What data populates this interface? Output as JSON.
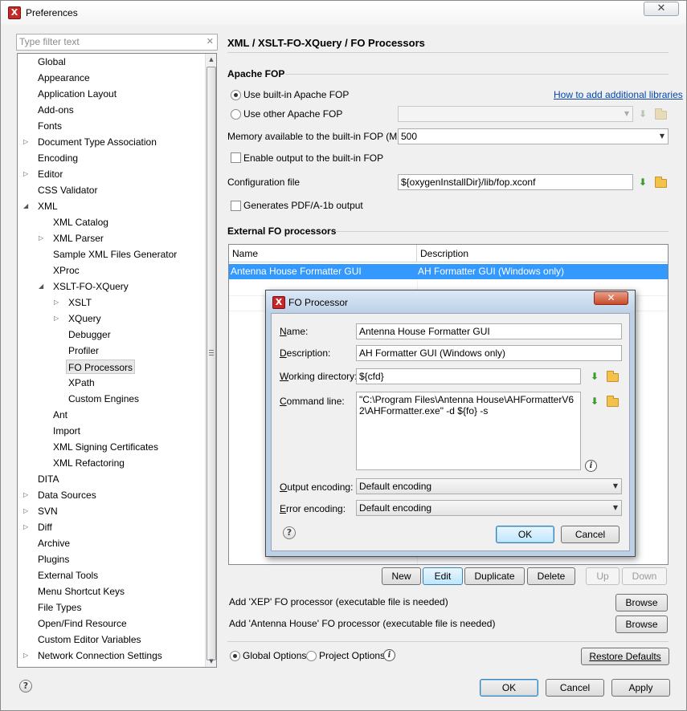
{
  "window": {
    "title": "Preferences",
    "close_glyph": "✕"
  },
  "filter": {
    "placeholder": "Type filter text",
    "clear_glyph": "✕"
  },
  "tree": [
    {
      "label": "Global",
      "level": 0,
      "expander": "none"
    },
    {
      "label": "Appearance",
      "level": 0,
      "expander": "none"
    },
    {
      "label": "Application Layout",
      "level": 0,
      "expander": "none"
    },
    {
      "label": "Add-ons",
      "level": 0,
      "expander": "none"
    },
    {
      "label": "Fonts",
      "level": 0,
      "expander": "none"
    },
    {
      "label": "Document Type Association",
      "level": 0,
      "expander": "collapsed"
    },
    {
      "label": "Encoding",
      "level": 0,
      "expander": "none"
    },
    {
      "label": "Editor",
      "level": 0,
      "expander": "collapsed"
    },
    {
      "label": "CSS Validator",
      "level": 0,
      "expander": "none"
    },
    {
      "label": "XML",
      "level": 0,
      "expander": "expanded"
    },
    {
      "label": "XML Catalog",
      "level": 1,
      "expander": "none"
    },
    {
      "label": "XML Parser",
      "level": 1,
      "expander": "collapsed"
    },
    {
      "label": "Sample XML Files Generator",
      "level": 1,
      "expander": "none"
    },
    {
      "label": "XProc",
      "level": 1,
      "expander": "none"
    },
    {
      "label": "XSLT-FO-XQuery",
      "level": 1,
      "expander": "expanded"
    },
    {
      "label": "XSLT",
      "level": 2,
      "expander": "collapsed"
    },
    {
      "label": "XQuery",
      "level": 2,
      "expander": "collapsed"
    },
    {
      "label": "Debugger",
      "level": 2,
      "expander": "none"
    },
    {
      "label": "Profiler",
      "level": 2,
      "expander": "none"
    },
    {
      "label": "FO Processors",
      "level": 2,
      "expander": "none",
      "selected": true
    },
    {
      "label": "XPath",
      "level": 2,
      "expander": "none"
    },
    {
      "label": "Custom Engines",
      "level": 2,
      "expander": "none"
    },
    {
      "label": "Ant",
      "level": 1,
      "expander": "none"
    },
    {
      "label": "Import",
      "level": 1,
      "expander": "none"
    },
    {
      "label": "XML Signing Certificates",
      "level": 1,
      "expander": "none"
    },
    {
      "label": "XML Refactoring",
      "level": 1,
      "expander": "none"
    },
    {
      "label": "DITA",
      "level": 0,
      "expander": "none"
    },
    {
      "label": "Data Sources",
      "level": 0,
      "expander": "collapsed"
    },
    {
      "label": "SVN",
      "level": 0,
      "expander": "collapsed"
    },
    {
      "label": "Diff",
      "level": 0,
      "expander": "collapsed"
    },
    {
      "label": "Archive",
      "level": 0,
      "expander": "none"
    },
    {
      "label": "Plugins",
      "level": 0,
      "expander": "none"
    },
    {
      "label": "External Tools",
      "level": 0,
      "expander": "none"
    },
    {
      "label": "Menu Shortcut Keys",
      "level": 0,
      "expander": "none"
    },
    {
      "label": "File Types",
      "level": 0,
      "expander": "none"
    },
    {
      "label": "Open/Find Resource",
      "level": 0,
      "expander": "none"
    },
    {
      "label": "Custom Editor Variables",
      "level": 0,
      "expander": "none"
    },
    {
      "label": "Network Connection Settings",
      "level": 0,
      "expander": "collapsed"
    }
  ],
  "page": {
    "title": "XML / XSLT-FO-XQuery / FO Processors",
    "apache_fop_section": "Apache FOP",
    "use_builtin_label": "Use built-in Apache FOP",
    "how_to_link": "How to add additional libraries",
    "use_other_label": "Use other Apache FOP",
    "memory_label": "Memory available to the built-in FOP (MB)",
    "memory_value": "500",
    "enable_output_label": "Enable output to the built-in FOP",
    "config_file_label": "Configuration file",
    "config_file_value": "${oxygenInstallDir}/lib/fop.xconf",
    "pdfa_label": "Generates PDF/A-1b output",
    "external_section": "External FO processors",
    "table": {
      "columns": [
        "Name",
        "Description"
      ],
      "rows": [
        {
          "name": "Antenna House Formatter GUI",
          "description": "AH Formatter GUI (Windows only)",
          "selected": true
        }
      ]
    },
    "buttons": {
      "new": "New",
      "edit": "Edit",
      "duplicate": "Duplicate",
      "delete": "Delete",
      "up": "Up",
      "down": "Down"
    },
    "add_xep_label": "Add 'XEP' FO processor (executable file is needed)",
    "add_antenna_label": "Add 'Antenna House' FO processor (executable file is needed)",
    "browse": "Browse",
    "global_options": "Global Options",
    "project_options": "Project Options",
    "restore_defaults": "Restore Defaults"
  },
  "footer": {
    "ok": "OK",
    "cancel": "Cancel",
    "apply": "Apply"
  },
  "dialog": {
    "title": "FO Processor",
    "close_glyph": "✕",
    "name_label": "Name:",
    "name_value": "Antenna House Formatter GUI",
    "description_label": "Description:",
    "description_value": "AH Formatter GUI (Windows only)",
    "working_dir_label": "Working directory:",
    "working_dir_value": "${cfd}",
    "command_line_label": "Command line:",
    "command_line_value": "\"C:\\Program Files\\Antenna House\\AHFormatterV62\\AHFormatter.exe\" -d ${fo} -s",
    "output_encoding_label": "Output encoding:",
    "output_encoding_value": "Default encoding",
    "error_encoding_label": "Error encoding:",
    "error_encoding_value": "Default encoding",
    "ok": "OK",
    "cancel": "Cancel"
  },
  "icons": {
    "app_glyph": "X",
    "help_glyph": "?",
    "info_glyph": "i",
    "download_glyph": "⬇"
  },
  "colors": {
    "selection": "#3399ff",
    "link": "#0645ad",
    "dialog_frame": "#bcd0e6"
  }
}
